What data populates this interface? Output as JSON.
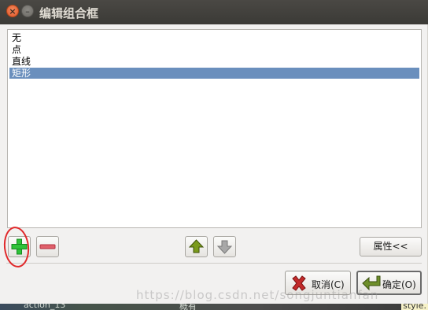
{
  "window": {
    "title": "编辑组合框"
  },
  "list": {
    "items": [
      {
        "label": "无",
        "selected": false
      },
      {
        "label": "点",
        "selected": false
      },
      {
        "label": "直线",
        "selected": false
      },
      {
        "label": "矩形",
        "selected": true
      }
    ]
  },
  "toolbar": {
    "properties_label": "属性<<"
  },
  "dialog": {
    "cancel_label": "取消(C)",
    "ok_label": "确定(O)"
  },
  "background": {
    "left_text": "action_13",
    "middle_text": "概有",
    "right_text": "style."
  },
  "watermark": "https://blog.csdn.net/songjuntianfan",
  "colors": {
    "selection": "#6a8fbd",
    "titlebar": "#3c3b37",
    "annotation": "#e0282a",
    "add_icon": "#2fc23a",
    "remove_icon": "#e0606a",
    "arrow_up": "#7a9a1c"
  }
}
